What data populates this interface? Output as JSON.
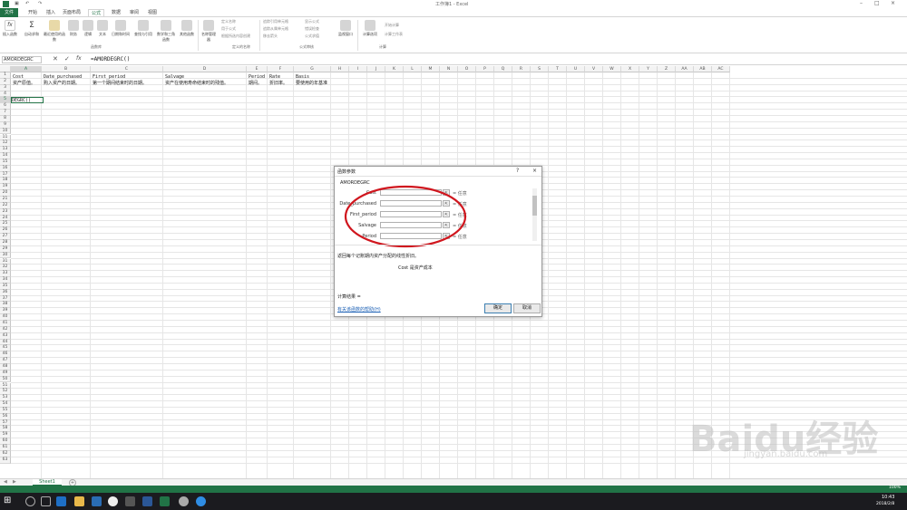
{
  "window": {
    "title": "工作簿1 - Excel"
  },
  "tabs": [
    {
      "label": "文件"
    },
    {
      "label": "开始"
    },
    {
      "label": "插入"
    },
    {
      "label": "页面布局"
    },
    {
      "label": "公式"
    },
    {
      "label": "数据"
    },
    {
      "label": "审阅"
    },
    {
      "label": "视图"
    }
  ],
  "ribbon": {
    "buttons": [
      {
        "label": "插入函数"
      },
      {
        "label": "自动求和"
      },
      {
        "label": "最近使用的函数"
      },
      {
        "label": "财务"
      },
      {
        "label": "逻辑"
      },
      {
        "label": "文本"
      },
      {
        "label": "日期和时间"
      },
      {
        "label": "查找与引用"
      },
      {
        "label": "数学和三角函数"
      },
      {
        "label": "其他函数"
      },
      {
        "label": "名称管理器"
      }
    ],
    "name_rows": [
      "定义名称",
      "用于公式",
      "根据所选内容创建"
    ],
    "audit_rows": [
      "追踪引用单元格",
      "追踪从属单元格",
      "移去箭头",
      "显示公式",
      "错误检查",
      "公式求值"
    ],
    "watch_label": "监视窗口",
    "calc_label": "计算选项",
    "calc_rows": [
      "开始计算",
      "计算工作表"
    ],
    "groups": {
      "library": "函数库",
      "names": "定义的名称",
      "audit": "公式审核",
      "calc": "计算"
    }
  },
  "formula_bar": {
    "namebox": "AMORDEGRC",
    "formula": "=AMORDEGRC()",
    "fx": "fx"
  },
  "columns": [
    "A",
    "B",
    "C",
    "D",
    "E",
    "F",
    "G",
    "H",
    "I",
    "J",
    "K",
    "L",
    "M",
    "N",
    "O",
    "P",
    "Q",
    "R",
    "S",
    "T",
    "U",
    "V",
    "W",
    "X",
    "Y",
    "Z",
    "AA",
    "AB",
    "AC"
  ],
  "rows": [
    "1",
    "2",
    "3",
    "4",
    "5",
    "6",
    "7",
    "8",
    "9",
    "10",
    "11",
    "12",
    "13",
    "14",
    "15",
    "16",
    "17",
    "18",
    "19",
    "20",
    "21",
    "22",
    "23",
    "24",
    "25",
    "26",
    "27",
    "28",
    "29",
    "30",
    "31",
    "32",
    "33",
    "34",
    "35",
    "36",
    "37",
    "38",
    "39",
    "40",
    "41",
    "42",
    "43",
    "44",
    "45",
    "46",
    "47",
    "48",
    "49",
    "50",
    "51",
    "52",
    "53",
    "54",
    "55",
    "56",
    "57",
    "58",
    "59",
    "60",
    "61",
    "62",
    "63"
  ],
  "cells": {
    "r1": [
      "Cost",
      "Date_purchased",
      "First_period",
      "Salvage",
      "Period",
      "Rate",
      "Basis"
    ],
    "r2": [
      "资产原值。",
      "购入资产的日期。",
      "第一个期间结束时的日期。",
      "资产在使用寿命结束时的残值。",
      "期间。",
      "折旧率。",
      "要使用的年基准"
    ],
    "a5": "DEGRC()"
  },
  "dialog": {
    "title": "函数参数",
    "help_char": "?",
    "close_char": "×",
    "function_name": "AMORDEGRC",
    "args": [
      {
        "label": "Cost",
        "result": "= 任意"
      },
      {
        "label": "Date_purchased",
        "result": "= 任意"
      },
      {
        "label": "First_period",
        "result": "= 任意"
      },
      {
        "label": "Salvage",
        "result": "= 任意"
      },
      {
        "label": "Period",
        "result": "= 任意"
      }
    ],
    "description": "返回每个记账期内资产分配的线性折旧。",
    "arg_description": "Cost  是资产成本",
    "result_label": "计算结果 =",
    "help_link": "有关该函数的帮助(H)",
    "ok": "确定",
    "cancel": "取消"
  },
  "sheet_tabs": {
    "sheet1": "Sheet1",
    "add": "+"
  },
  "status": {
    "zoom": "100%"
  },
  "taskbar": {
    "time": "10:43",
    "date": "2018/2/8"
  },
  "watermark": {
    "main": "Baidu经验",
    "sub": "jingyan.baidu.com"
  },
  "colors": {
    "excel_green": "#217346",
    "annotation_red": "#d0161e"
  }
}
